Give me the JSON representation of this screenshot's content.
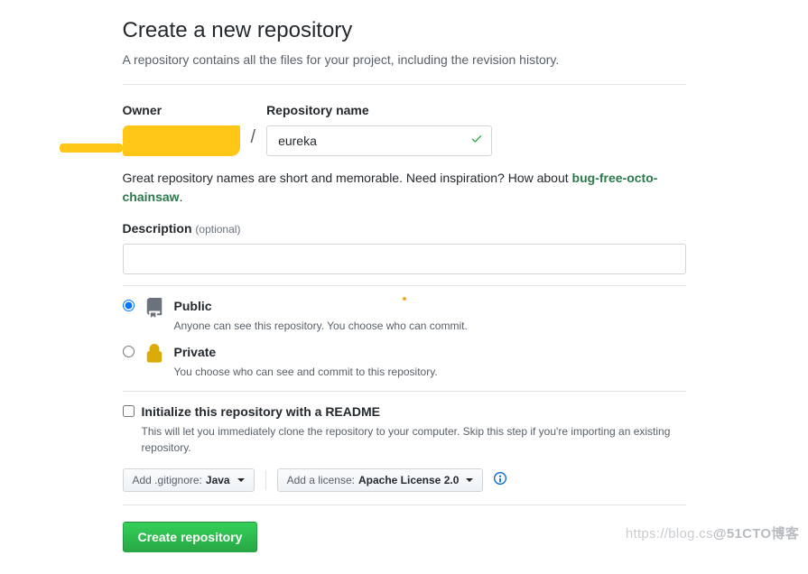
{
  "title": "Create a new repository",
  "subtitle": "A repository contains all the files for your project, including the revision history.",
  "owner": {
    "label": "Owner"
  },
  "repo_name": {
    "label": "Repository name",
    "value": "eureka"
  },
  "hint": {
    "text_before": "Great repository names are short and memorable. Need inspiration? How about ",
    "suggestion": "bug-free-octo-chainsaw",
    "text_after": "."
  },
  "description": {
    "label": "Description",
    "optional": "(optional)",
    "value": ""
  },
  "visibility": {
    "public": {
      "title": "Public",
      "sub": "Anyone can see this repository. You choose who can commit.",
      "checked": true
    },
    "private": {
      "title": "Private",
      "sub": "You choose who can see and commit to this repository.",
      "checked": false
    }
  },
  "readme": {
    "title": "Initialize this repository with a README",
    "sub": "This will let you immediately clone the repository to your computer. Skip this step if you're importing an existing repository.",
    "checked": false
  },
  "dropdowns": {
    "gitignore_prefix": "Add .gitignore: ",
    "gitignore_value": "Java",
    "license_prefix": "Add a license: ",
    "license_value": "Apache License 2.0"
  },
  "submit": "Create repository",
  "watermark": {
    "left": "https://blog.cs",
    "right": "@51CTO博客"
  }
}
